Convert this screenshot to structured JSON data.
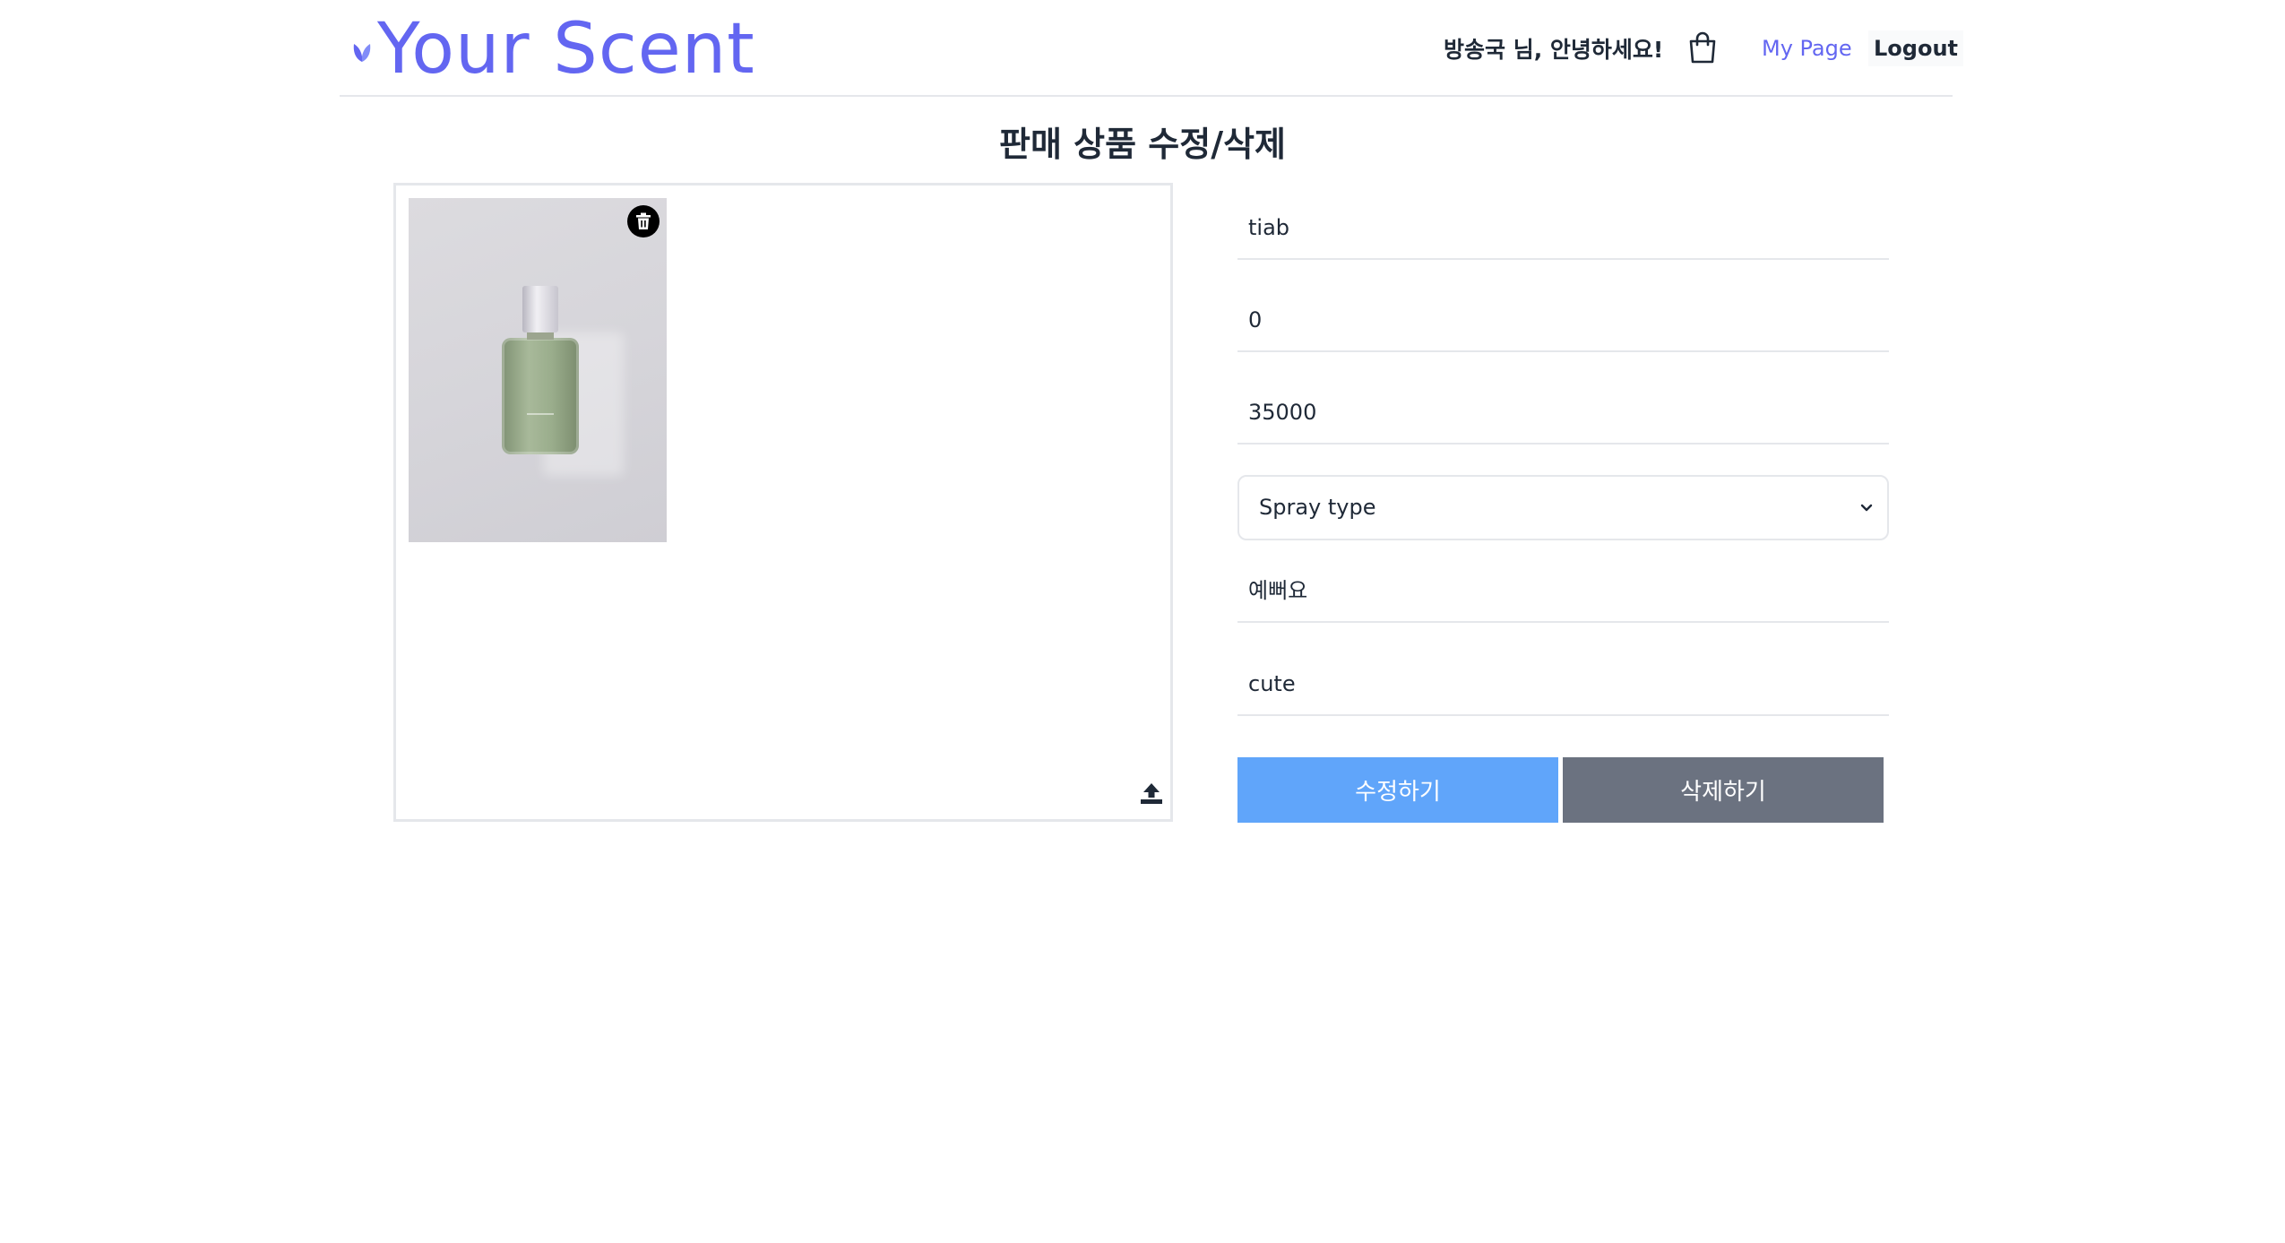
{
  "header": {
    "logo_text": "Your Scent",
    "greeting": "방송국 님, 안녕하세요!",
    "my_page_label": "My Page",
    "logout_label": "Logout",
    "brand_color": "#6366f1"
  },
  "page": {
    "title": "판매 상품 수정/삭제"
  },
  "image_panel": {
    "thumbnail_icon": "perfume-bottle-photo",
    "delete_icon": "trash-icon",
    "upload_icon": "upload-icon"
  },
  "form": {
    "name_value": "tiab",
    "stock_value": "0",
    "price_value": "35000",
    "type_selected": "Spray type",
    "description_value": "예뻐요",
    "tag_value": "cute",
    "edit_label": "수정하기",
    "delete_label": "삭제하기",
    "edit_color": "#60a5fa",
    "delete_color": "#6b7280"
  }
}
